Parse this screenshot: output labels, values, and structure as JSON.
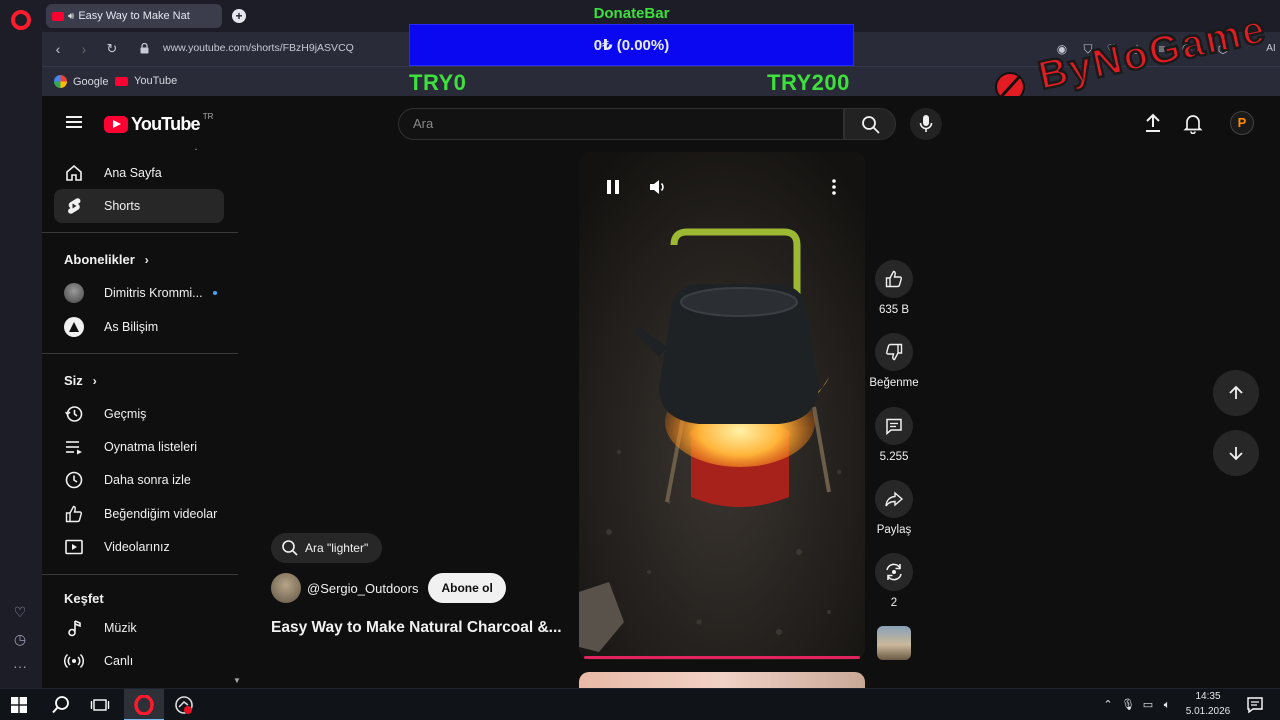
{
  "browser": {
    "tab": {
      "title": "Easy Way to Make Nat"
    },
    "new_tab_label": "+",
    "url": "www.youtube.com/shorts/FBzH9jASVCQ",
    "bookmarks": [
      {
        "label": "Google"
      },
      {
        "label": "YouTube"
      }
    ],
    "right_icons": [
      "eye-icon",
      "shield-icon",
      "heart-icon",
      "download-icon",
      "menu-icon",
      "profile-icon",
      "cube-icon"
    ],
    "ai_label": "AI"
  },
  "donate": {
    "title": "DonateBar",
    "progress_text": "0₺ (0.00%)",
    "progress": 0,
    "min_label": "TRY0",
    "max_label": "TRY200"
  },
  "watermark": {
    "text": "ByNoGame"
  },
  "youtube": {
    "logo_text": "YouTube",
    "country_code": "TR",
    "search_placeholder": "Ara",
    "avatar_letter": "P",
    "guide": {
      "items_top": [
        {
          "label": "Ana Sayfa",
          "icon": "home-icon"
        },
        {
          "label": "Shorts",
          "icon": "shorts-icon"
        }
      ],
      "subscriptions_heading": "Abonelikler",
      "subscriptions": [
        {
          "label": "Dimitris Krommi..."
        },
        {
          "label": "As Bilişim"
        }
      ],
      "you_heading": "Siz",
      "you_items": [
        {
          "label": "Geçmiş",
          "icon": "history-icon"
        },
        {
          "label": "Oynatma listeleri",
          "icon": "playlist-icon"
        },
        {
          "label": "Daha sonra izle",
          "icon": "watch-later-icon"
        },
        {
          "label": "Beğendiğim videolar",
          "icon": "thumbs-up-icon"
        },
        {
          "label": "Videolarınız",
          "icon": "your-videos-icon"
        }
      ],
      "explore_heading": "Keşfet",
      "explore_items": [
        {
          "label": "Müzik",
          "icon": "music-icon"
        },
        {
          "label": "Canlı",
          "icon": "live-icon"
        }
      ]
    },
    "short": {
      "search_chip": "Ara \"lighter\"",
      "channel": "@Sergio_Outdoors",
      "subscribe_label": "Abone ol",
      "title": "Easy Way to Make Natural Charcoal &...",
      "actions": {
        "likes": "635 B",
        "dislike_label": "Beğenme",
        "comments": "5.255",
        "share_label": "Paylaş",
        "remix_count": "2"
      }
    }
  },
  "taskbar": {
    "time": "14:35",
    "date": "5.01.2026"
  }
}
